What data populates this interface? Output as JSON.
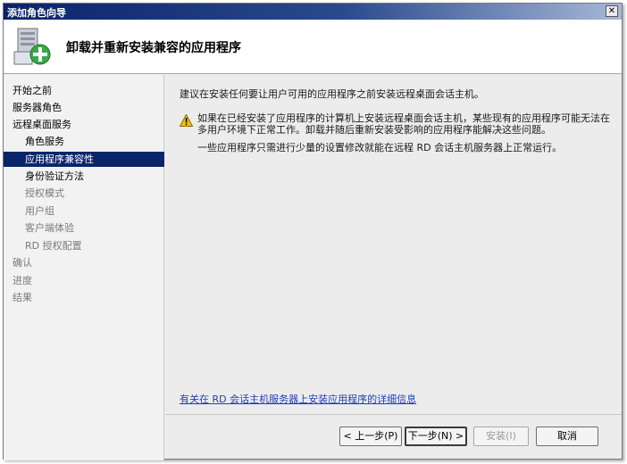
{
  "window": {
    "title": "添加角色向导",
    "close_glyph": "✕"
  },
  "header": {
    "title": "卸载并重新安装兼容的应用程序",
    "icon": "server-add-role-icon"
  },
  "sidebar": {
    "items": [
      {
        "label": "开始之前",
        "state": "normal"
      },
      {
        "label": "服务器角色",
        "state": "normal"
      },
      {
        "label": "远程桌面服务",
        "state": "normal"
      },
      {
        "label": "角色服务",
        "state": "normal"
      },
      {
        "label": "应用程序兼容性",
        "state": "selected"
      },
      {
        "label": "身份验证方法",
        "state": "normal"
      },
      {
        "label": "授权模式",
        "state": "disabled"
      },
      {
        "label": "用户组",
        "state": "disabled"
      },
      {
        "label": "客户端体验",
        "state": "disabled"
      },
      {
        "label": "RD 授权配置",
        "state": "disabled"
      },
      {
        "label": "确认",
        "state": "disabled"
      },
      {
        "label": "进度",
        "state": "disabled"
      },
      {
        "label": "结果",
        "state": "disabled"
      }
    ]
  },
  "content": {
    "intro": "建议在安装任何要让用户可用的应用程序之前安装远程桌面会话主机。",
    "warning_line1": "如果在已经安装了应用程序的计算机上安装远程桌面会话主机，某些现有的应用程序可能无法在",
    "warning_line2": "多用户环境下正常工作。卸载并随后重新安装受影响的应用程序能解决这些问题。",
    "note": "一些应用程序只需进行少量的设置修改就能在远程 RD 会话主机服务器上正常运行。",
    "more_link": "有关在 RD 会话主机服务器上安装应用程序的详细信息",
    "warning_icon": "warning-icon"
  },
  "footer": {
    "back_label": "< 上一步(P)",
    "next_label": "下一步(N) >",
    "install_label": "安装(I)",
    "cancel_label": "取消"
  },
  "colors": {
    "selected_bg": "#0a246a",
    "link": "#1d3fb5"
  }
}
